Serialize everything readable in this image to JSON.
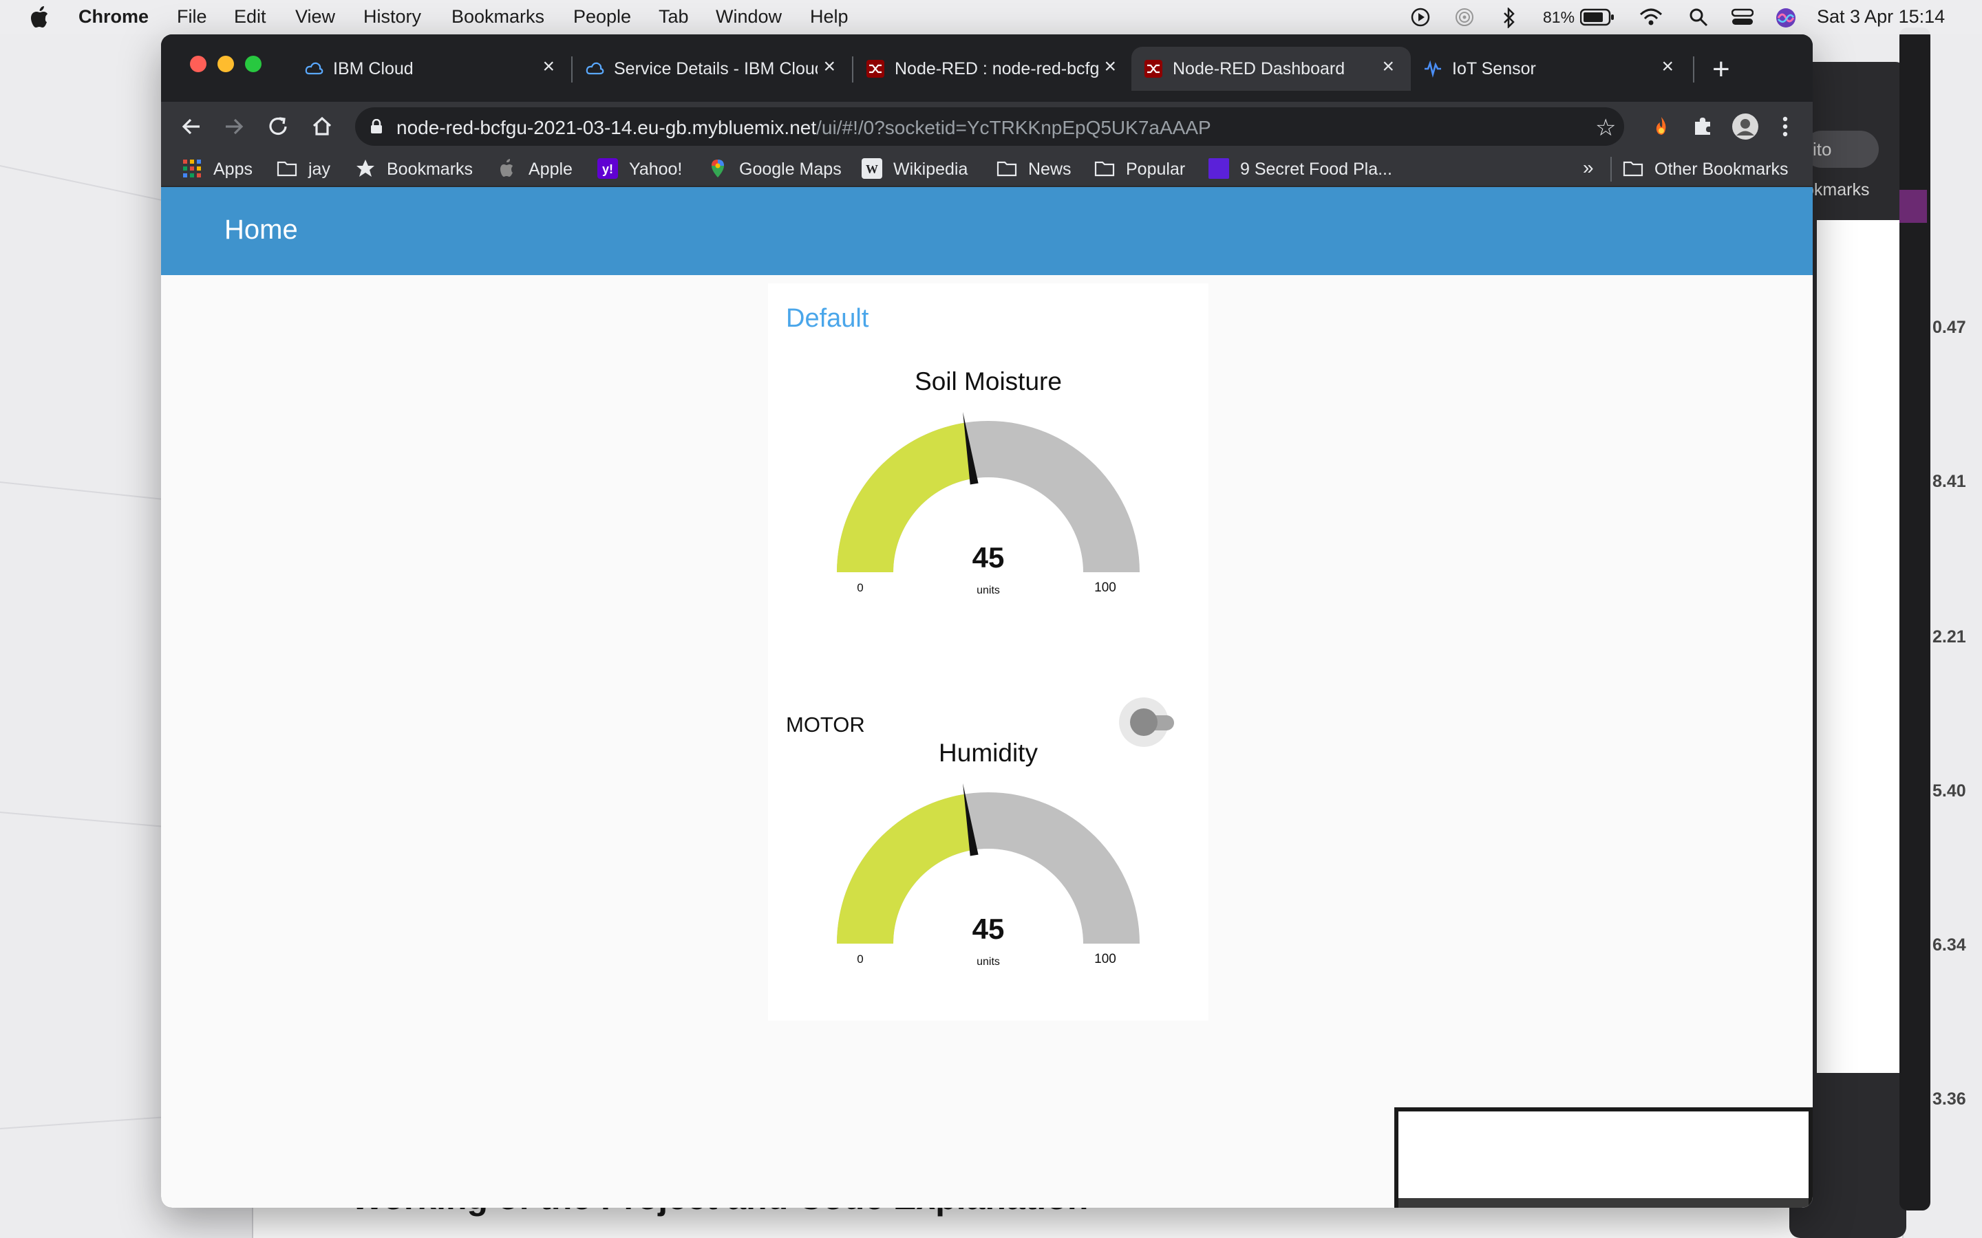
{
  "menubar": {
    "app_name": "Chrome",
    "menus": [
      "File",
      "Edit",
      "View",
      "History",
      "Bookmarks",
      "People",
      "Tab",
      "Window",
      "Help"
    ],
    "battery_percent": "81%",
    "datetime": "Sat 3 Apr  15:14"
  },
  "browser": {
    "tabs": [
      {
        "title": "IBM Cloud",
        "icon": "ibm-cloud-icon",
        "active": false
      },
      {
        "title": "Service Details - IBM Cloud",
        "icon": "ibm-cloud-icon",
        "active": false
      },
      {
        "title": "Node-RED : node-red-bcfgu",
        "icon": "node-red-icon",
        "active": false
      },
      {
        "title": "Node-RED Dashboard",
        "icon": "node-red-icon",
        "active": true
      },
      {
        "title": "IoT Sensor",
        "icon": "iot-sensor-icon",
        "active": false
      }
    ],
    "url_host": "node-red-bcfgu-2021-03-14.eu-gb.mybluemix.net",
    "url_path": "/ui/#!/0?socketid=YcTRKKnpEpQ5UK7aAAAP",
    "bookmarks": [
      {
        "label": "Apps",
        "icon": "apps-grid-icon"
      },
      {
        "label": "jay",
        "icon": "folder-icon"
      },
      {
        "label": "Bookmarks",
        "icon": "star-icon"
      },
      {
        "label": "Apple",
        "icon": "apple-icon"
      },
      {
        "label": "Yahoo!",
        "icon": "yahoo-icon"
      },
      {
        "label": "Google Maps",
        "icon": "google-maps-icon"
      },
      {
        "label": "Wikipedia",
        "icon": "wikipedia-icon"
      },
      {
        "label": "News",
        "icon": "folder-icon"
      },
      {
        "label": "Popular",
        "icon": "folder-icon"
      },
      {
        "label": "9 Secret Food Pla...",
        "icon": "bookmark-page-icon"
      }
    ],
    "bookmarks_overflow": "»",
    "other_bookmarks": "Other Bookmarks"
  },
  "dashboard": {
    "header_title": "Home",
    "group_title": "Default",
    "soil_moisture": {
      "title": "Soil Moisture",
      "value": 45,
      "min": 0,
      "max": 100,
      "value_text": "45",
      "min_text": "0",
      "max_text": "100",
      "units": "units"
    },
    "motor": {
      "label": "MOTOR",
      "state": false
    },
    "humidity": {
      "title": "Humidity",
      "value": 45,
      "min": 0,
      "max": 100,
      "value_text": "45",
      "min_text": "0",
      "max_text": "100",
      "units": "units"
    },
    "colors": {
      "header": "#3f93cd",
      "gauge_fill": "#d2df46",
      "gauge_bg": "#c0c0c0",
      "group_title": "#4aa6ea"
    }
  },
  "background": {
    "doc_heading": "Working of the Project and Code Explanation",
    "incognito_fragment": "ito",
    "bookmarks_fragment": "okmarks",
    "edge_numbers": [
      "0.47",
      "8.41",
      "2.21",
      "5.40",
      "6.34",
      "3.36"
    ]
  }
}
